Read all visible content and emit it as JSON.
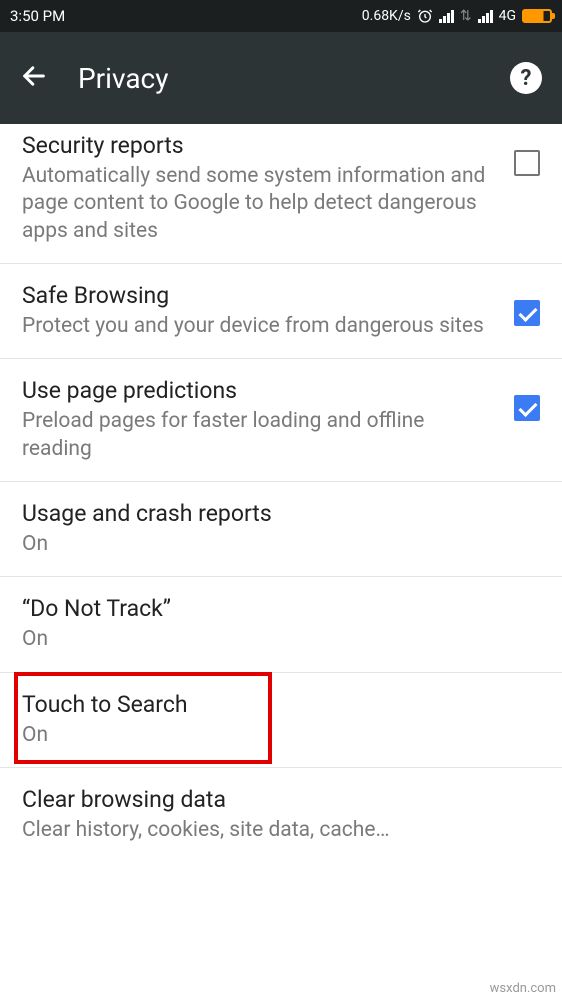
{
  "status_bar": {
    "time": "3:50 PM",
    "speed": "0.68K/s",
    "network": "4G"
  },
  "app_bar": {
    "title": "Privacy"
  },
  "settings": {
    "security_reports": {
      "title": "Security reports",
      "sub": "Automatically send some system information and page content to Google to help detect dangerous apps and sites"
    },
    "safe_browsing": {
      "title": "Safe Browsing",
      "sub": "Protect you and your device from dangerous sites"
    },
    "page_predictions": {
      "title": "Use page predictions",
      "sub": "Preload pages for faster loading and offline reading"
    },
    "usage_crash": {
      "title": "Usage and crash reports",
      "sub": "On"
    },
    "do_not_track": {
      "title": "“Do Not Track”",
      "sub": "On"
    },
    "touch_search": {
      "title": "Touch to Search",
      "sub": "On"
    },
    "clear_data": {
      "title": "Clear browsing data",
      "sub": "Clear history, cookies, site data, cache…"
    }
  },
  "watermark": "wsxdn.com"
}
